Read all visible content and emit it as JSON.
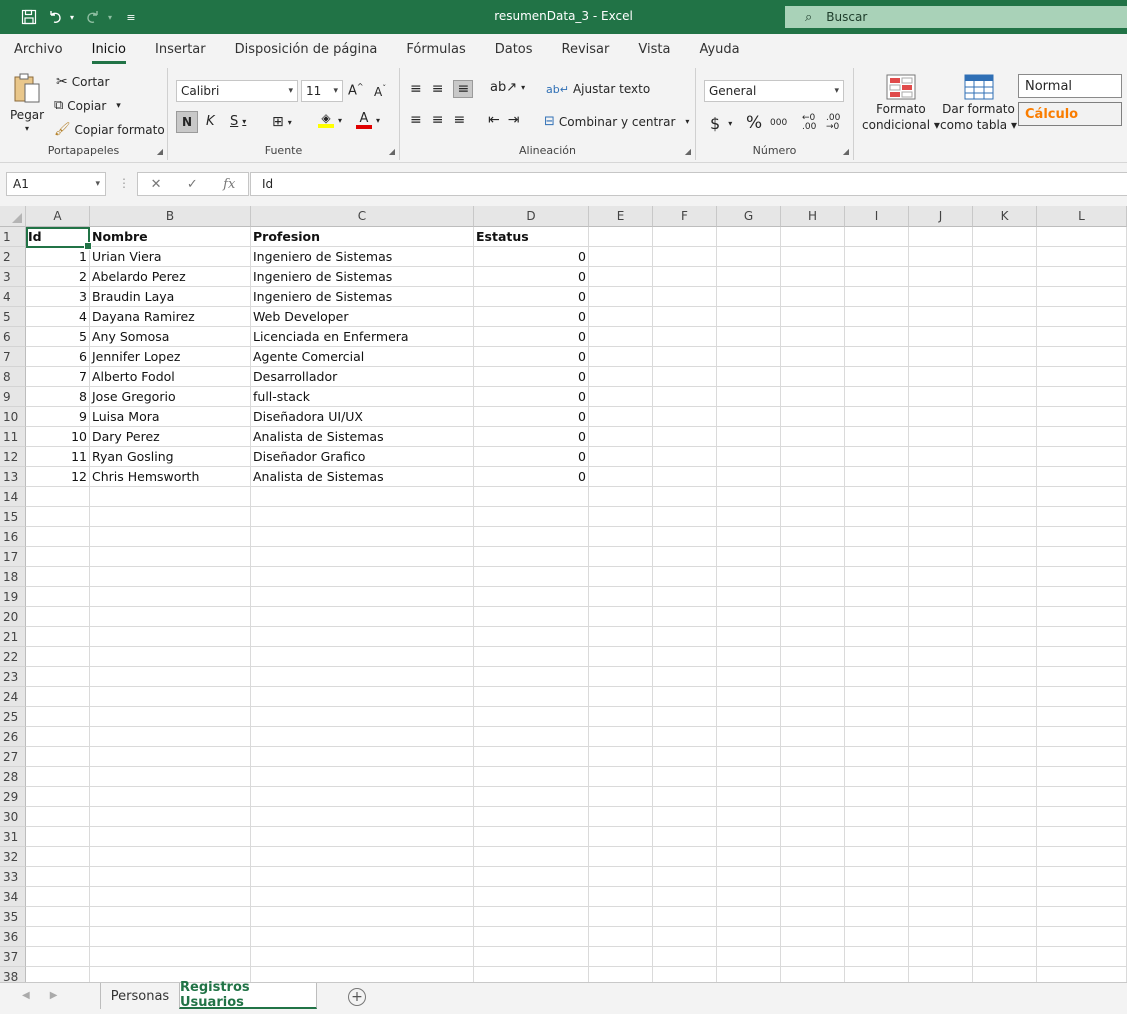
{
  "window": {
    "document_title": "resumenData_3  -  Excel",
    "search_placeholder": "Buscar"
  },
  "menu": {
    "tabs": [
      "Archivo",
      "Inicio",
      "Insertar",
      "Disposición de página",
      "Fórmulas",
      "Datos",
      "Revisar",
      "Vista",
      "Ayuda"
    ],
    "active": "Inicio"
  },
  "ribbon": {
    "clipboard": {
      "label": "Portapapeles",
      "paste": "Pegar",
      "cut": "Cortar",
      "copy": "Copiar",
      "format_painter": "Copiar formato"
    },
    "font": {
      "label": "Fuente",
      "family": "Calibri",
      "size": "11",
      "bold": "N",
      "italic": "K",
      "underline": "S"
    },
    "alignment": {
      "label": "Alineación",
      "wrap_text": "Ajustar texto",
      "merge_center": "Combinar y centrar"
    },
    "number": {
      "label": "Número",
      "format": "General",
      "currency": "$",
      "percent": "%",
      "thousands": "000"
    },
    "styles": {
      "conditional_line1": "Formato",
      "conditional_line2": "condicional",
      "table_line1": "Dar formato",
      "table_line2": "como tabla",
      "style_normal": "Normal",
      "style_calc": "Cálculo"
    }
  },
  "formula_bar": {
    "name_box": "A1",
    "fx": "fx",
    "content": "Id"
  },
  "sheet": {
    "columns": [
      "A",
      "B",
      "C",
      "D",
      "E",
      "F",
      "G",
      "H",
      "I",
      "J",
      "K",
      "L"
    ],
    "header": [
      "Id",
      "Nombre",
      "Profesion",
      "Estatus"
    ],
    "rows": [
      [
        "1",
        "Urian Viera",
        "Ingeniero de Sistemas",
        "0"
      ],
      [
        "2",
        "Abelardo Perez",
        "Ingeniero de Sistemas",
        "0"
      ],
      [
        "3",
        "Braudin Laya",
        "Ingeniero de Sistemas",
        "0"
      ],
      [
        "4",
        "Dayana Ramirez",
        "Web Developer",
        "0"
      ],
      [
        "5",
        "Any Somosa",
        "Licenciada en Enfermera",
        "0"
      ],
      [
        "6",
        "Jennifer Lopez",
        "Agente Comercial",
        "0"
      ],
      [
        "7",
        "Alberto Fodol",
        "Desarrollador",
        "0"
      ],
      [
        "8",
        "Jose Gregorio",
        "full-stack",
        "0"
      ],
      [
        "9",
        "Luisa Mora",
        "Diseñadora UI/UX",
        "0"
      ],
      [
        "10",
        "Dary Perez",
        "Analista de Sistemas",
        "0"
      ],
      [
        "11",
        "Ryan Gosling",
        "Diseñador Grafico",
        "0"
      ],
      [
        "12",
        "Chris Hemsworth",
        "Analista de Sistemas",
        "0"
      ]
    ],
    "row_numbers": [
      "1",
      "2",
      "3",
      "4",
      "5",
      "6",
      "7",
      "8",
      "9",
      "10",
      "11",
      "12",
      "13",
      "14",
      "15",
      "16",
      "17",
      "18",
      "19",
      "20",
      "21",
      "22",
      "23",
      "24",
      "25",
      "26",
      "27",
      "28",
      "29",
      "30",
      "31",
      "32",
      "33",
      "34",
      "35",
      "36",
      "37",
      "38"
    ]
  },
  "sheet_tabs": {
    "tabs": [
      "Personas",
      "Registros Usuarios"
    ],
    "active": "Registros Usuarios"
  },
  "colors": {
    "accent": "#217346",
    "calc_style": "#fa7d00"
  }
}
